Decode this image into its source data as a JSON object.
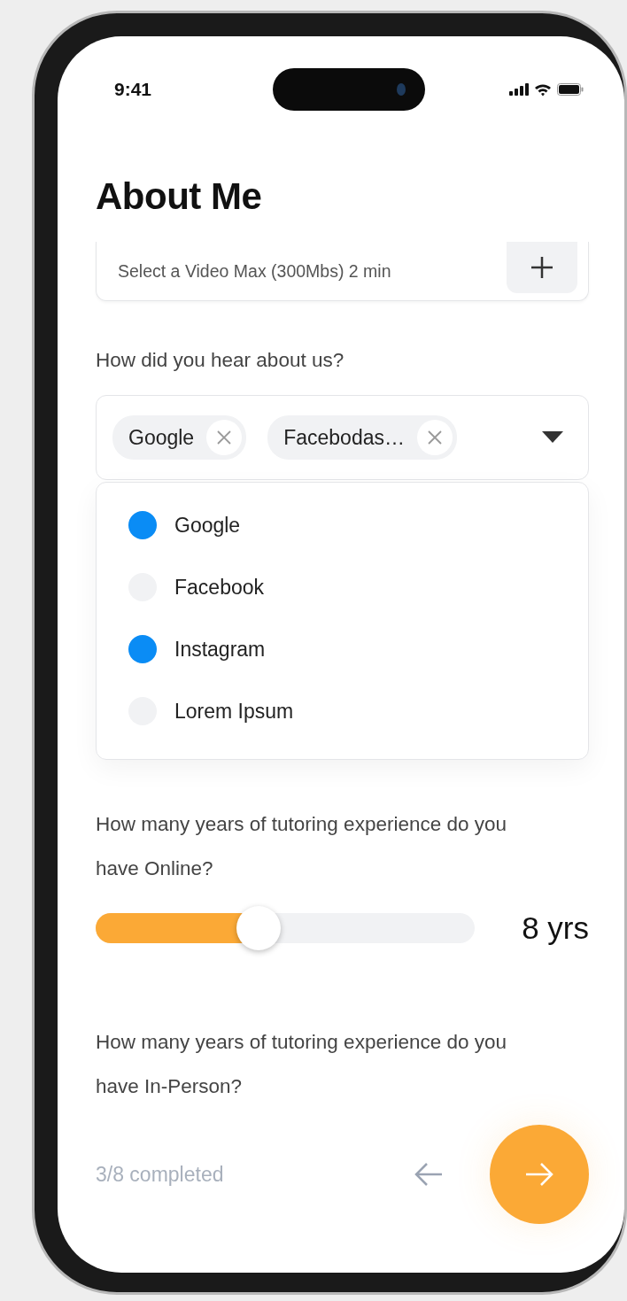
{
  "status_bar": {
    "time": "9:41"
  },
  "title": "About Me",
  "video_field": {
    "placeholder": "Select a Video Max (300Mbs) 2 min"
  },
  "source_question": {
    "label": "How did you hear about us?",
    "chips": [
      "Google",
      "Facebodas…"
    ],
    "expanded": true,
    "options": [
      {
        "label": "Google",
        "selected": true
      },
      {
        "label": "Facebook",
        "selected": false
      },
      {
        "label": "Instagram",
        "selected": true
      },
      {
        "label": "Lorem Ipsum",
        "selected": false
      }
    ]
  },
  "online_question": {
    "label": "How many years of tutoring experience do you have Online?",
    "level": 0.43,
    "reading": "8 yrs"
  },
  "in_person_question": {
    "label": "How many years of tutoring experience do you have In-Person?"
  },
  "footer": {
    "progress": "3/8 completed"
  }
}
